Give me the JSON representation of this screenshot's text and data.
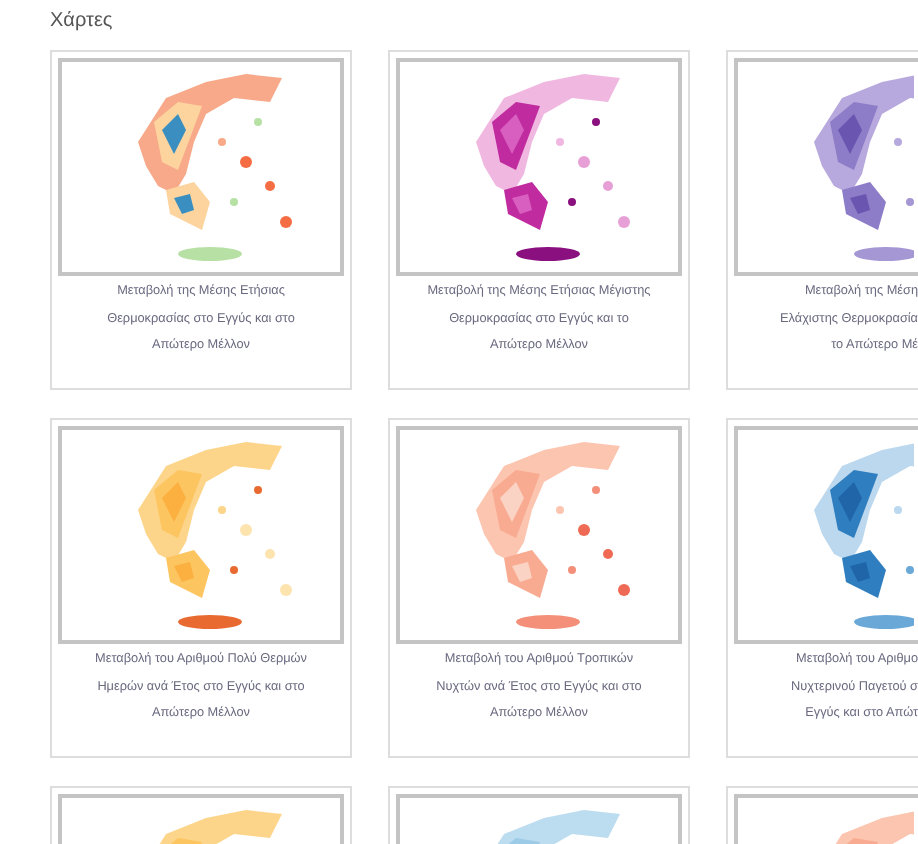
{
  "heading": "Χάρτες",
  "maps": [
    {
      "kind": "picture",
      "cut_at_edge": false,
      "caption": [
        "Μεταβολή της Μέσης Ετήσιας",
        "Θερμοκρασίας στο Εγγύς και στο",
        "Απώτερο Μέλλον"
      ]
    },
    {
      "kind": "picture",
      "cut_at_edge": false,
      "caption": [
        "Μεταβολή της Μέσης Ετήσιας Μέγιστης",
        "Θερμοκρασίας στο Εγγύς και το",
        "Απώτερο Μέλλον"
      ]
    },
    {
      "kind": "picture",
      "cut_at_edge": true,
      "caption": [
        "Μεταβολή της Μέση",
        "Ελάχιστης Θερμοκρασία",
        "το Απώτερο Μέ"
      ]
    },
    {
      "kind": "picture",
      "cut_at_edge": false,
      "caption": [
        "Μεταβολή του Αριθμού Πολύ Θερμών",
        "Ημερών ανά Έτος στο Εγγύς και στο",
        "Απώτερο Μέλλον"
      ]
    },
    {
      "kind": "picture",
      "cut_at_edge": false,
      "caption": [
        "Μεταβολή του Αριθμού Τροπικών",
        "Νυχτών ανά Έτος στο Εγγύς και στο",
        "Απώτερο Μέλλον"
      ]
    },
    {
      "kind": "picture",
      "cut_at_edge": true,
      "caption": [
        "Μεταβολή του Αριθμο",
        "Νυχτερινού Παγετού σ",
        "Εγγύς και στο Απώτ"
      ]
    },
    {
      "kind": "picture",
      "cut_at_edge": false
    },
    {
      "kind": "picture",
      "cut_at_edge": false
    },
    {
      "kind": "picture",
      "cut_at_edge": true
    }
  ]
}
